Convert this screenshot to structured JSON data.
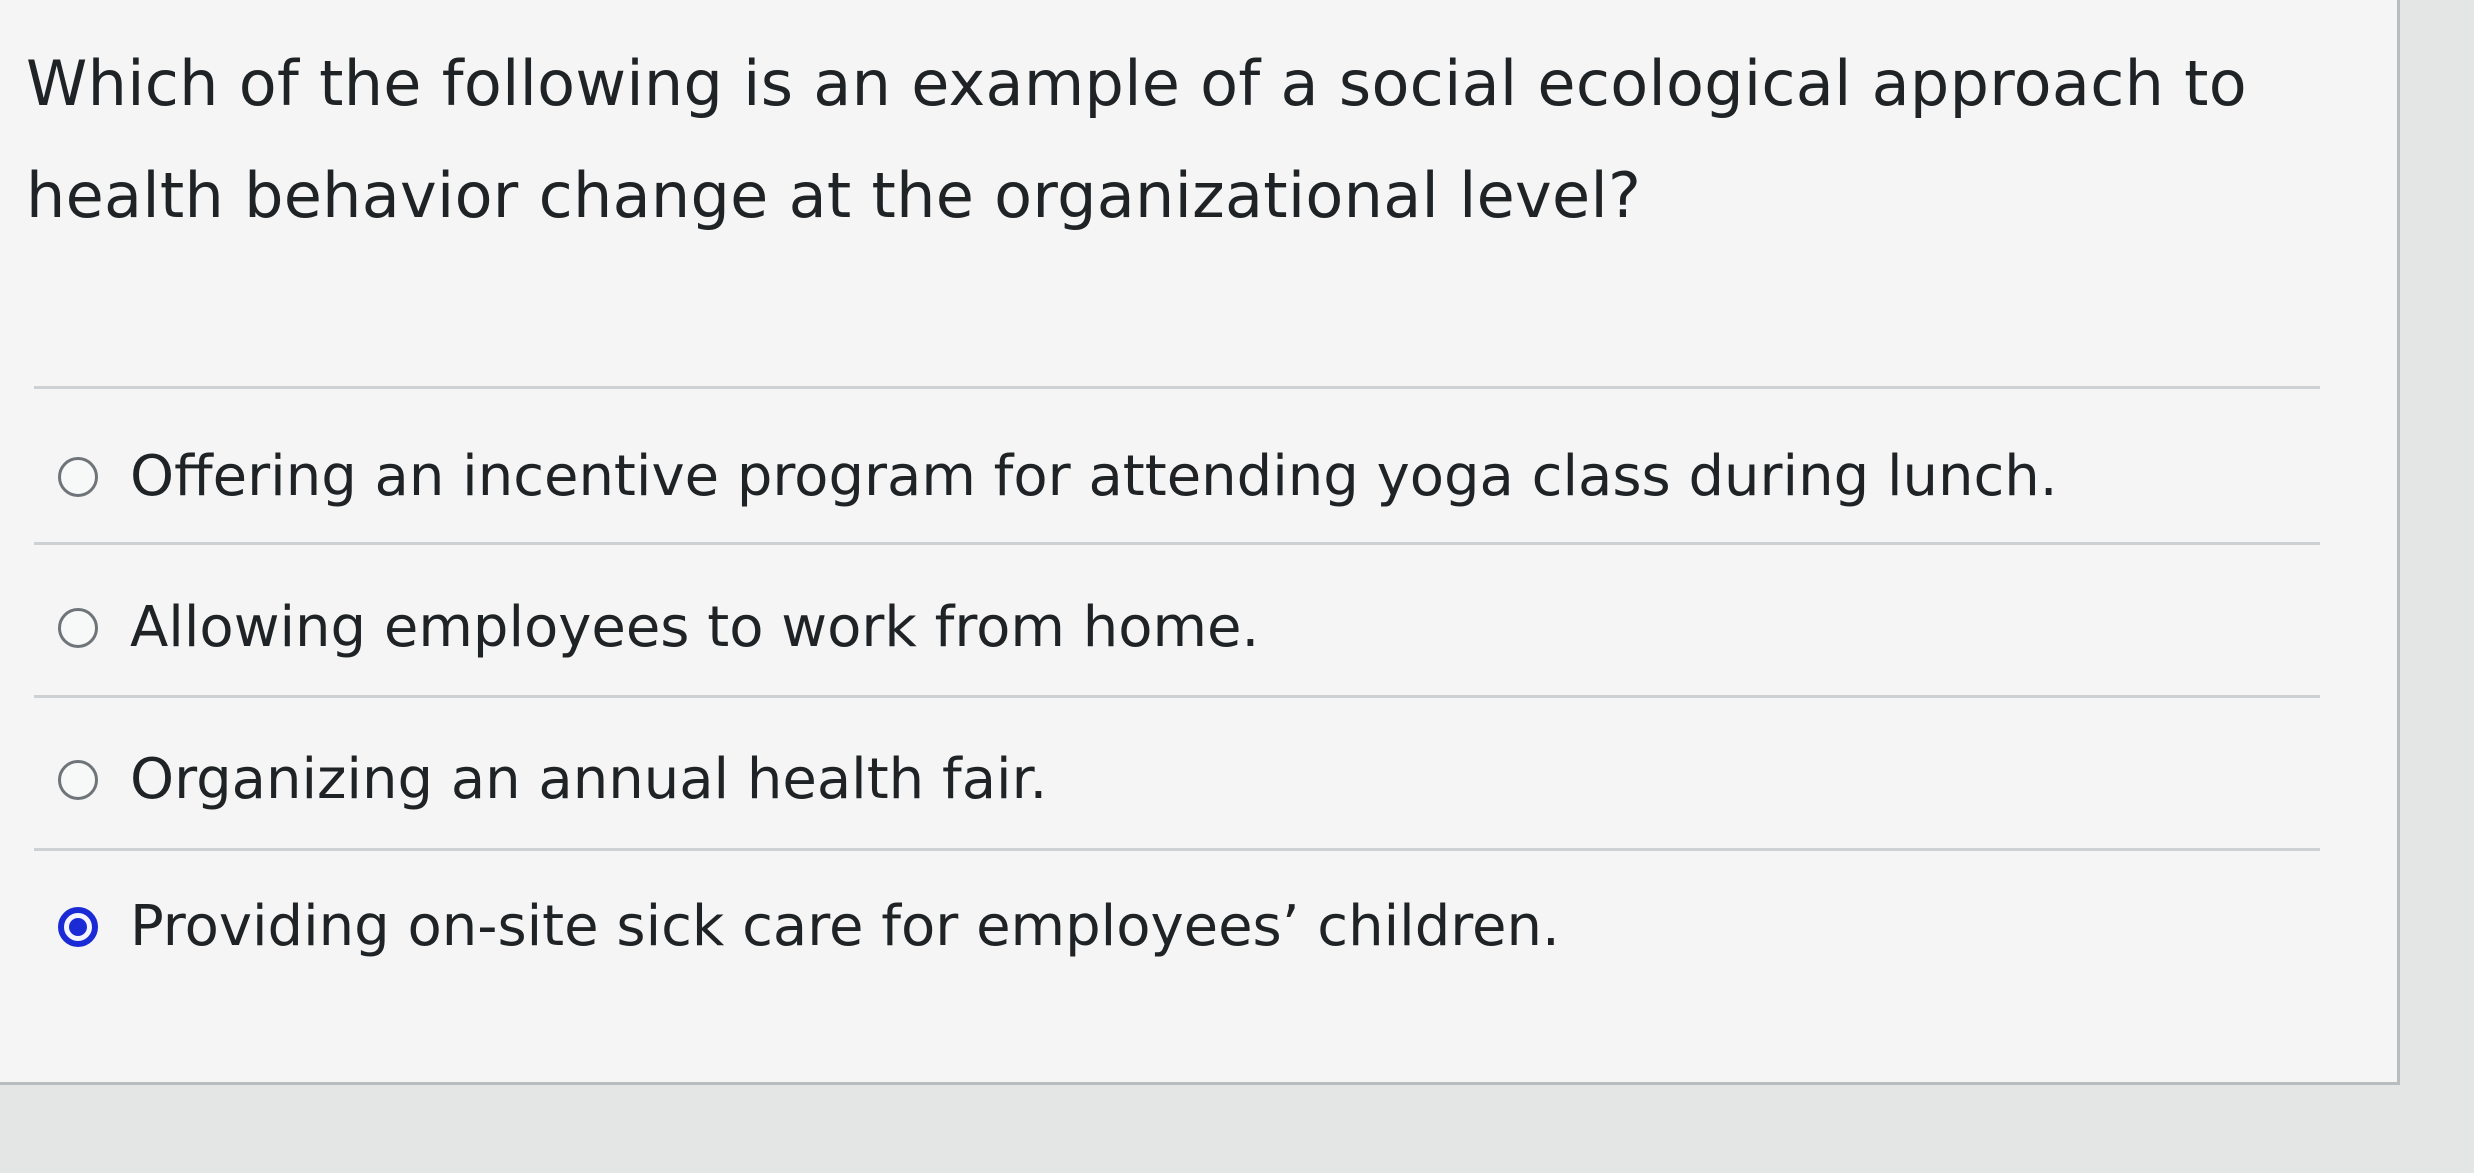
{
  "question": {
    "text": "Which of the following is an example of a social ecological approach to health behavior change at the organizational level?"
  },
  "options": [
    {
      "label": "Offering an incentive program for attending yoga class during lunch.",
      "selected": false
    },
    {
      "label": "Allowing employees to work from home.",
      "selected": false
    },
    {
      "label": "Organizing an annual health fair.",
      "selected": false
    },
    {
      "label": "Providing on-site sick care for employees’ children.",
      "selected": true
    }
  ],
  "colors": {
    "selected_radio": "#1a2bd6",
    "unselected_radio_border": "#6f7479",
    "text": "#1f2326"
  }
}
